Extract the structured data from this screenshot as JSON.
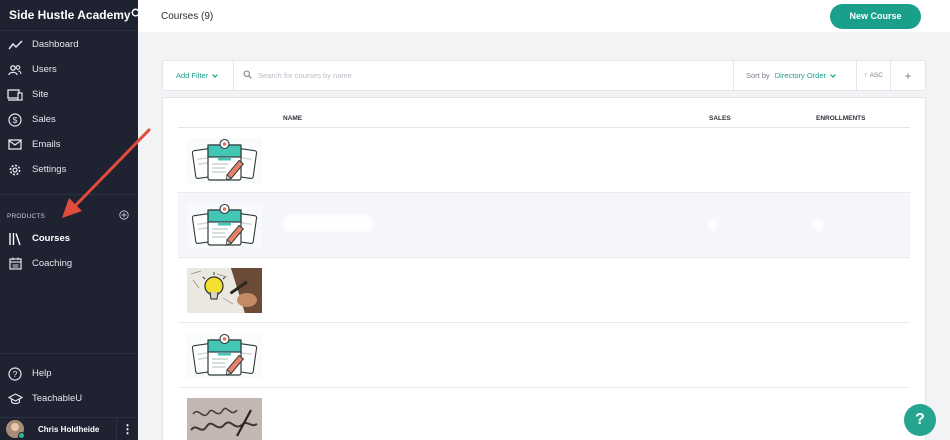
{
  "sidebar": {
    "brand": "Side Hustle Academy",
    "items": [
      {
        "label": "Dashboard",
        "icon": "trend-line-icon"
      },
      {
        "label": "Users",
        "icon": "users-icon"
      },
      {
        "label": "Site",
        "icon": "site-icon"
      },
      {
        "label": "Sales",
        "icon": "dollar-icon"
      },
      {
        "label": "Emails",
        "icon": "mail-icon"
      },
      {
        "label": "Settings",
        "icon": "gear-icon"
      }
    ],
    "section_label": "PRODUCTS",
    "products": [
      {
        "label": "Courses",
        "icon": "library-icon",
        "active": true
      },
      {
        "label": "Coaching",
        "icon": "calendar-icon",
        "active": false
      }
    ],
    "bottom": [
      {
        "label": "Help",
        "icon": "question-icon"
      },
      {
        "label": "TeachableU",
        "icon": "graduation-cap-icon"
      }
    ],
    "user": "Chris Holdheide"
  },
  "header": {
    "title": "Courses (9)",
    "new_button": "New Course"
  },
  "filters": {
    "add_filter": "Add Filter",
    "search_placeholder": "Search for courses by name",
    "sort_label": "Sort by",
    "sort_value": "Directory Order",
    "order": "ASC"
  },
  "table": {
    "columns": [
      "NAME",
      "SALES",
      "ENROLLMENTS"
    ],
    "rows": [
      {
        "thumbnail": "course-document-illustration",
        "highlighted": false
      },
      {
        "thumbnail": "course-document-illustration",
        "highlighted": true
      },
      {
        "thumbnail": "lightbulb-sketch-photo",
        "highlighted": false
      },
      {
        "thumbnail": "course-document-illustration",
        "highlighted": false
      },
      {
        "thumbnail": "hustle-handwriting-photo",
        "highlighted": false
      }
    ]
  },
  "colors": {
    "sidebar_bg": "#1f2231",
    "accent": "#1aa08a",
    "annotation_arrow": "#e24a3b"
  }
}
